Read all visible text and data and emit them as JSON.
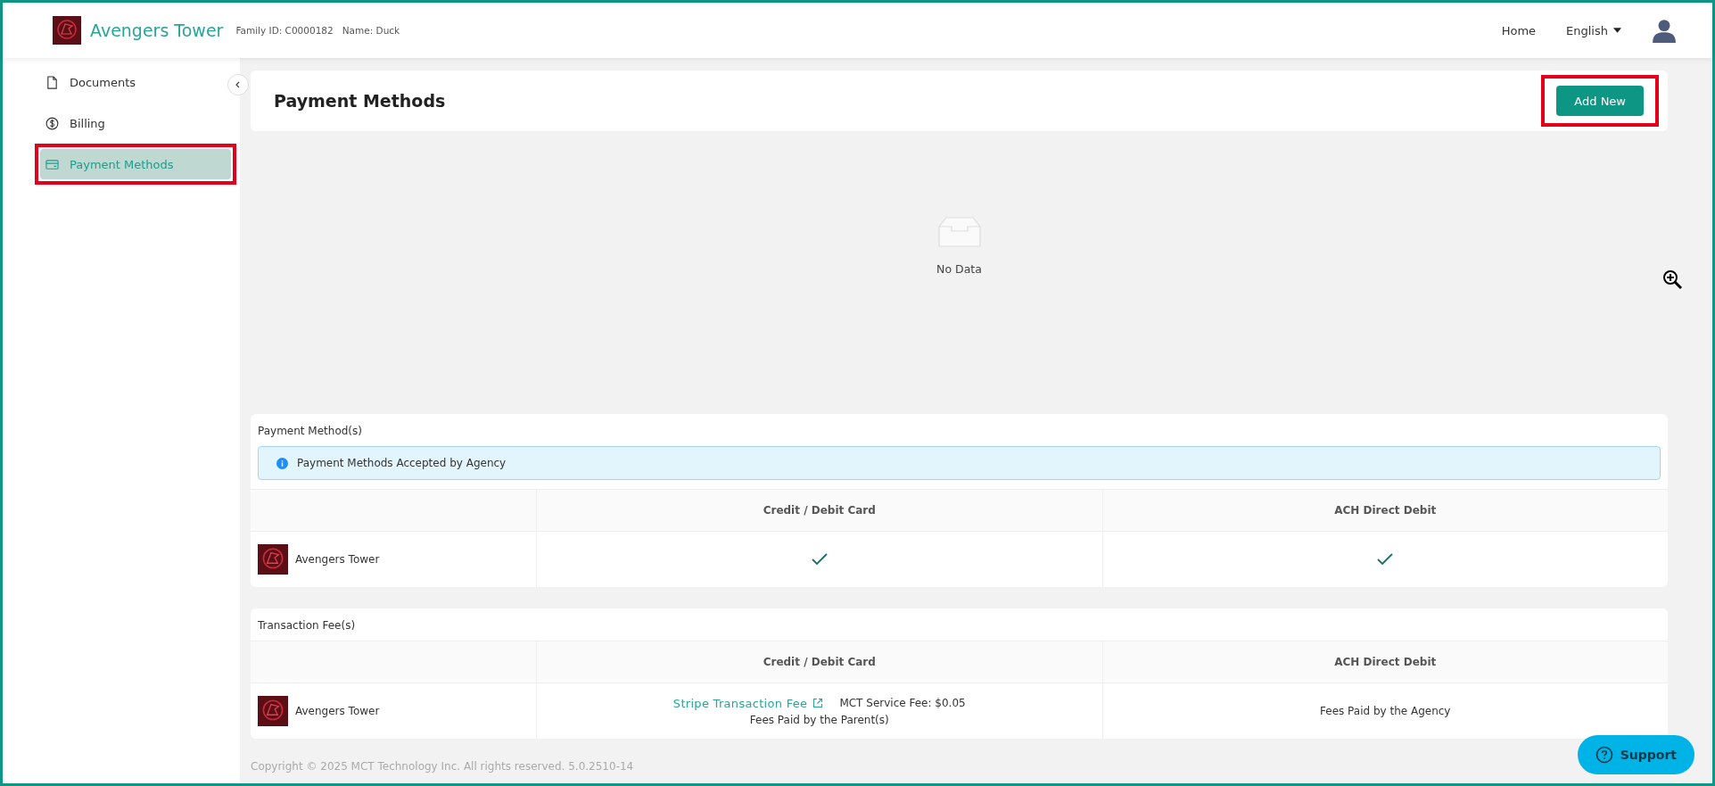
{
  "header": {
    "title": "Avengers Tower",
    "family_id": "Family ID: C0000182",
    "name": "Name: Duck",
    "nav": [
      {
        "label": "Home"
      }
    ],
    "language": "English"
  },
  "sidebar": {
    "items": [
      {
        "label": "Documents",
        "kind": "document",
        "selected": false,
        "highlighted": false
      },
      {
        "label": "Billing",
        "kind": "dollar",
        "selected": false,
        "highlighted": false
      },
      {
        "label": "Payment Methods",
        "kind": "card",
        "selected": true,
        "highlighted": true
      }
    ]
  },
  "page": {
    "title": "Payment Methods",
    "add_button": {
      "label": "Add New",
      "highlighted": true
    },
    "empty_text": "No Data"
  },
  "payment_methods": {
    "title": "Payment Method(s)",
    "info": "Payment Methods Accepted by Agency",
    "columns": [
      "Credit / Debit Card",
      "ACH Direct Debit"
    ],
    "rows": [
      {
        "agency": "Avengers Tower",
        "accepted": [
          true,
          true
        ]
      }
    ]
  },
  "transaction_fees": {
    "title": "Transaction Fee(s)",
    "columns": [
      "Credit / Debit Card",
      "ACH Direct Debit"
    ],
    "rows": [
      {
        "agency": "Avengers Tower",
        "cells": [
          {
            "link": "Stripe Transaction Fee",
            "service_fee": "MCT Service Fee: $0.05",
            "note": "Fees Paid by the Parent(s)"
          },
          {
            "note": "Fees Paid by the Agency"
          }
        ]
      }
    ]
  },
  "footer": {
    "copyright": "Copyright © 2025 MCT Technology Inc. All rights reserved. 5.0.2510-14"
  },
  "support": {
    "label": "Support"
  }
}
